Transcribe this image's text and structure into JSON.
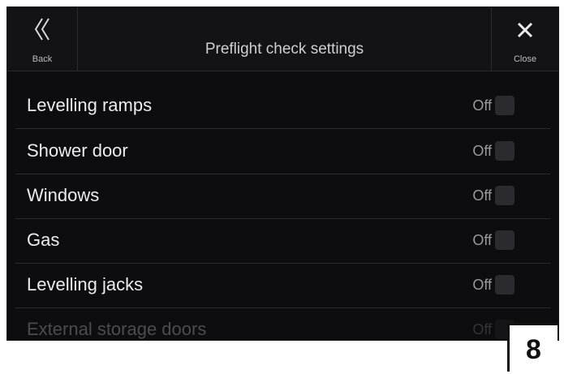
{
  "header": {
    "title": "Preflight check settings",
    "back_label": "Back",
    "close_label": "Close"
  },
  "settings": [
    {
      "label": "Levelling ramps",
      "status": "Off"
    },
    {
      "label": "Shower door",
      "status": "Off"
    },
    {
      "label": "Windows",
      "status": "Off"
    },
    {
      "label": "Gas",
      "status": "Off"
    },
    {
      "label": "Levelling jacks",
      "status": "Off"
    },
    {
      "label": "External storage doors",
      "status": "Off"
    }
  ],
  "page_number": "8",
  "colors": {
    "background": "#0d0d0f",
    "header": "#131316",
    "text": "#ececec",
    "status_text": "#9a9a9a",
    "toggle_off": "#2b2b2f"
  },
  "icons": {
    "back": "double-chevron-left-icon",
    "close": "close-icon"
  }
}
